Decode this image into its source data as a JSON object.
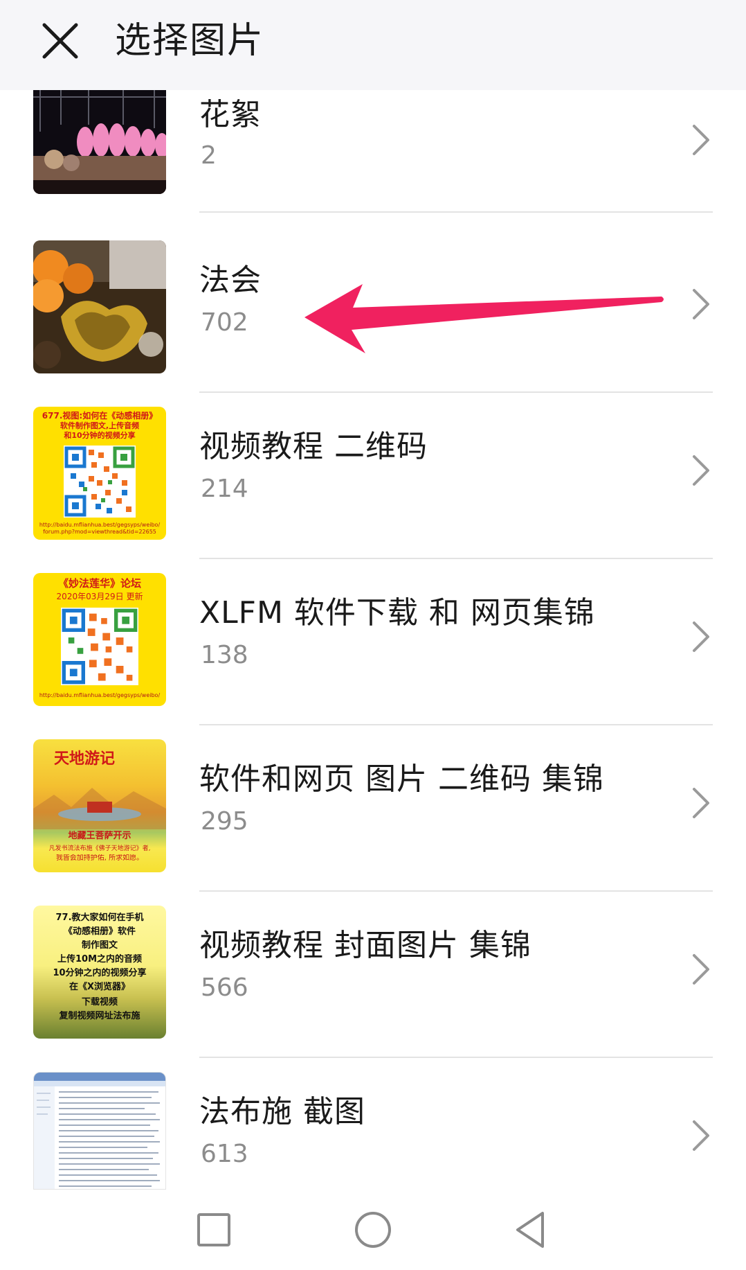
{
  "header": {
    "title": "选择图片",
    "close_icon": "close-icon"
  },
  "albums": [
    {
      "title": "花絮",
      "count": "2",
      "thumb": "stage-flowers"
    },
    {
      "title": "法会",
      "count": "702",
      "thumb": "offerings-table"
    },
    {
      "title": "视频教程 二维码",
      "count": "214",
      "thumb": "qr-yellow-poster-1",
      "thumb_text": [
        "677.视图:如何在《动感相册》",
        "软件制作图文,上传音频",
        "和10分钟的视频分享",
        "http://baidu.mflianhua.best/gegsyps/weibo/",
        "forum.php?mod=viewthread&tid=22655"
      ]
    },
    {
      "title": "XLFM 软件下载 和 网页集锦",
      "count": "138",
      "thumb": "qr-yellow-poster-2",
      "thumb_text": [
        "《妙法莲华》论坛",
        "2020年03月29日 更新",
        "http://baidu.mflianhua.best/gegsyps/weibo/"
      ]
    },
    {
      "title": "软件和网页 图片 二维码 集锦",
      "count": "295",
      "thumb": "tiandi-youji-poster",
      "thumb_text": [
        "天地游记",
        "地藏王菩萨开示",
        "凡发书流法布施《佛子天地游记》者,",
        "我皆会加持护佑, 所求如愿。"
      ]
    },
    {
      "title": "视频教程 封面图片 集锦",
      "count": "566",
      "thumb": "tutorial-cover",
      "thumb_text": [
        "77.教大家如何在手机",
        "《动感相册》软件",
        "制作图文",
        "上传10M之内的音频",
        "10分钟之内的视频分享",
        "在《X浏览器》",
        "下载视频",
        "复制视频网址法布施"
      ]
    },
    {
      "title": "法布施 截图",
      "count": "613",
      "thumb": "screenshot-thumb"
    }
  ],
  "chevron_icon": "chevron-right-icon",
  "annotation": {
    "color": "#f0215f",
    "icon": "arrow-left-annotation"
  },
  "navbar": {
    "recents_icon": "square-icon",
    "home_icon": "circle-icon",
    "back_icon": "triangle-back-icon"
  },
  "colors": {
    "header_bg": "#f6f6f9",
    "title": "#1a1a1a",
    "count": "#8c8c8c",
    "divider": "#e3e3e3",
    "chevron": "#9a9a9a",
    "poster_yellow": "#ffe000"
  }
}
